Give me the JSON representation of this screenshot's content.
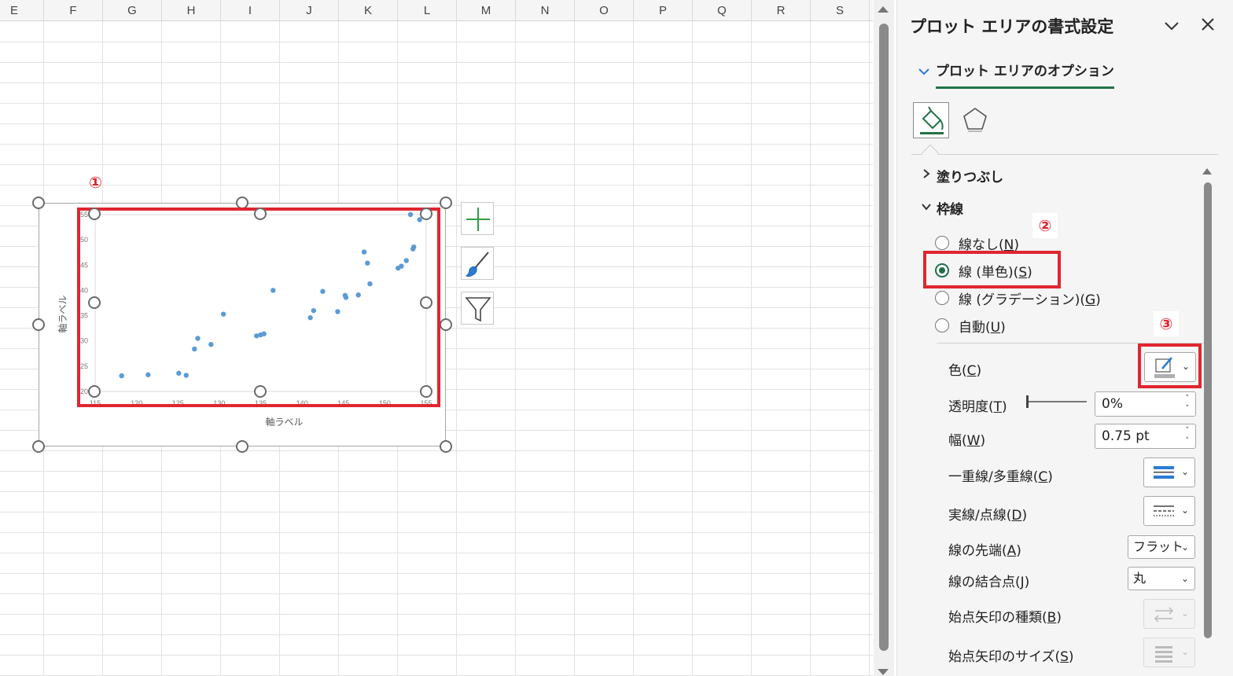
{
  "sheet": {
    "columns": [
      "E",
      "F",
      "G",
      "H",
      "I",
      "J",
      "K",
      "L",
      "M",
      "N",
      "O",
      "P",
      "Q",
      "R",
      "S"
    ]
  },
  "chart_data": {
    "type": "scatter",
    "xlabel": "軸ラベル",
    "ylabel": "軸ラベル",
    "xlim": [
      115,
      155
    ],
    "ylim": [
      20,
      55
    ],
    "xticks": [
      "115",
      "120",
      "125",
      "130",
      "135",
      "140",
      "145",
      "150",
      "155"
    ],
    "yticks": [
      "20",
      "25",
      "30",
      "35",
      "40",
      "45",
      "50",
      "55"
    ],
    "points": [
      [
        118.2,
        23.1
      ],
      [
        121.4,
        23.3
      ],
      [
        125.1,
        23.6
      ],
      [
        126.0,
        23.2
      ],
      [
        127.0,
        28.4
      ],
      [
        127.4,
        30.5
      ],
      [
        129.0,
        29.3
      ],
      [
        130.5,
        35.3
      ],
      [
        134.5,
        31.0
      ],
      [
        135.0,
        31.2
      ],
      [
        135.4,
        31.4
      ],
      [
        136.5,
        40.0
      ],
      [
        141.0,
        34.6
      ],
      [
        141.4,
        36.0
      ],
      [
        142.5,
        39.8
      ],
      [
        144.3,
        35.8
      ],
      [
        145.2,
        39.0
      ],
      [
        145.3,
        38.6
      ],
      [
        146.8,
        39.1
      ],
      [
        147.5,
        47.6
      ],
      [
        147.9,
        45.4
      ],
      [
        148.2,
        41.3
      ],
      [
        151.6,
        44.4
      ],
      [
        152.0,
        44.8
      ],
      [
        152.6,
        45.9
      ],
      [
        153.4,
        48.2
      ],
      [
        153.5,
        48.6
      ],
      [
        153.1,
        55.0
      ],
      [
        154.2,
        54.0
      ]
    ],
    "color": "#5b9bd5"
  },
  "chart_buttons": {
    "elements": "+",
    "styles": "brush",
    "filters": "funnel"
  },
  "markers": {
    "m1": "①",
    "m2": "②",
    "m3": "③"
  },
  "pane": {
    "title": "プロット エリアの書式設定",
    "options_tab": "プロット エリアのオプション",
    "fill_section": "塗りつぶし",
    "border_section": "枠線",
    "radio_none": {
      "text": "線なし(",
      "key": "N",
      "end": ")"
    },
    "radio_solid": {
      "text": "線 (単色)(",
      "key": "S",
      "end": ")"
    },
    "radio_gradient": {
      "text": "線 (グラデーション)(",
      "key": "G",
      "end": ")"
    },
    "radio_auto": {
      "text": "自動(",
      "key": "U",
      "end": ")"
    },
    "color_label": {
      "text": "色(",
      "key": "C",
      "end": ")"
    },
    "transparency_label": {
      "text": "透明度(",
      "key": "T",
      "end": ")"
    },
    "transparency_value": "0%",
    "width_label": {
      "text": "幅(",
      "key": "W",
      "end": ")"
    },
    "width_value": "0.75 pt",
    "compound_label": {
      "text": "一重線/多重線(",
      "key": "C",
      "end": ")"
    },
    "dash_label": {
      "text": "実線/点線(",
      "key": "D",
      "end": ")"
    },
    "cap_label": {
      "text": "線の先端(",
      "key": "A",
      "end": ")"
    },
    "cap_value": "フラット",
    "join_label": {
      "text": "線の結合点(",
      "key": "J",
      "end": ")"
    },
    "join_value": "丸",
    "begin_arrow_type_label": {
      "text": "始点矢印の種類(",
      "key": "B",
      "end": ")"
    },
    "begin_arrow_size_label": {
      "text": "始点矢印のサイズ(",
      "key": "S",
      "end": ")"
    },
    "accent": "#217346",
    "highlight": "#e0262f"
  }
}
